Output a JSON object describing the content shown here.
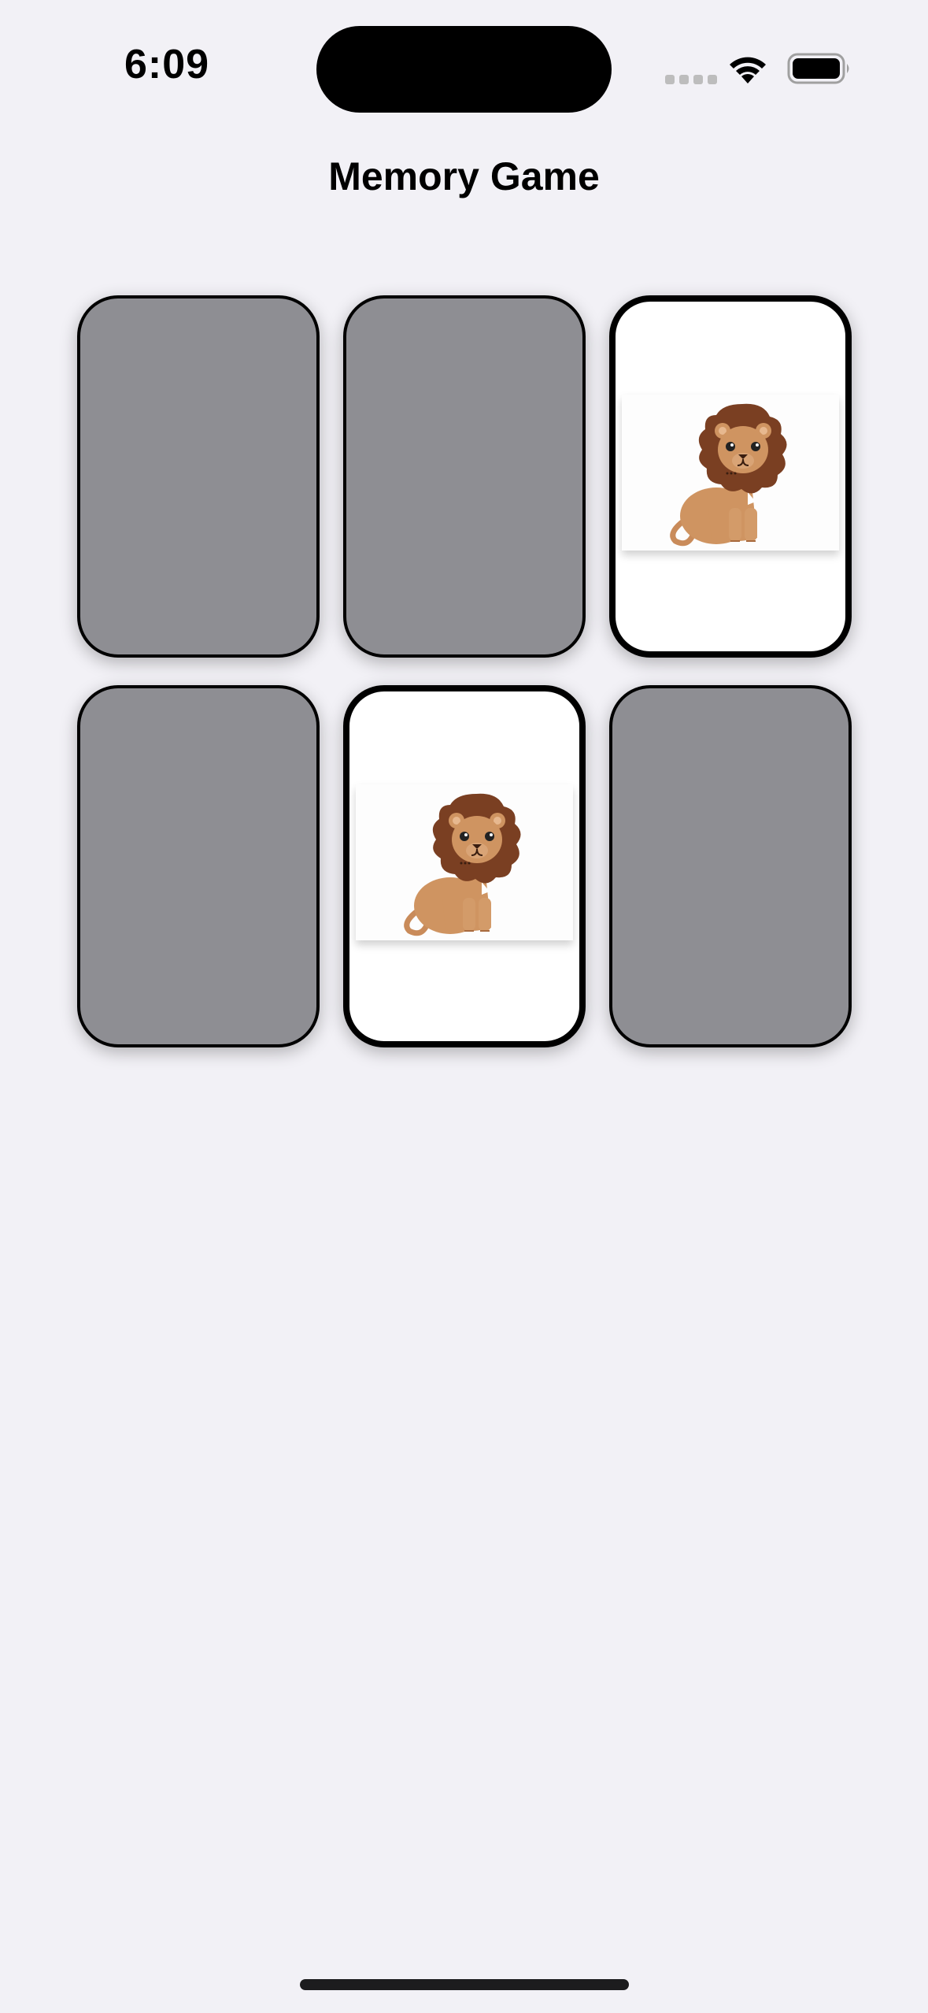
{
  "status_bar": {
    "time": "6:09"
  },
  "app": {
    "title": "Memory Game"
  },
  "cards": [
    {
      "state": "face-down"
    },
    {
      "state": "face-down"
    },
    {
      "state": "face-up",
      "image": "lion-icon"
    },
    {
      "state": "face-down"
    },
    {
      "state": "face-up",
      "image": "lion-icon"
    },
    {
      "state": "face-down"
    }
  ],
  "colors": {
    "background": "#f2f1f6",
    "card_back": "#8e8e93",
    "card_face": "#ffffff",
    "card_border": "#000000",
    "lion_mane": "#7a3f22",
    "lion_body": "#cf9461"
  }
}
